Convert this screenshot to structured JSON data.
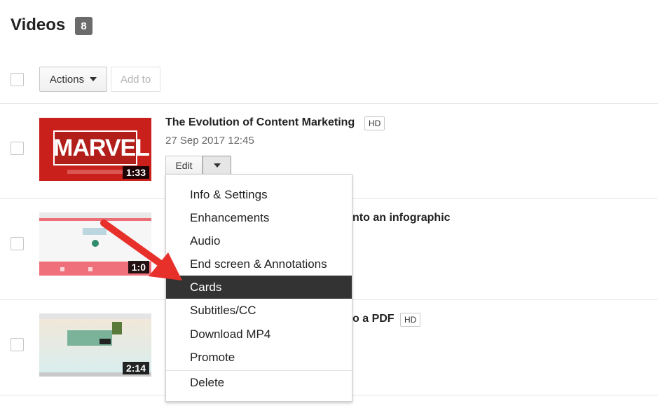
{
  "header": {
    "title": "Videos",
    "count": "8"
  },
  "toolbar": {
    "actions_label": "Actions",
    "add_to_label": "Add to"
  },
  "videos": [
    {
      "title": "The Evolution of Content Marketing",
      "hd": "HD",
      "date": "27 Sep 2017 12:45",
      "duration": "1:33",
      "thumb_text": "MARVEL"
    },
    {
      "title": "nto an infographic",
      "duration": "1:0"
    },
    {
      "title": "o a PDF",
      "hd": "HD",
      "duration": "2:14"
    }
  ],
  "edit_button": {
    "label": "Edit"
  },
  "menu": {
    "items": [
      "Info & Settings",
      "Enhancements",
      "Audio",
      "End screen & Annotations",
      "Cards",
      "Subtitles/CC",
      "Download MP4",
      "Promote",
      "Delete"
    ],
    "active_item": "Cards"
  },
  "colors": {
    "menu_active_bg": "#333333",
    "count_badge_bg": "#6b6b6b",
    "arrow": "#e8302a",
    "thumb_marvel_bg": "#c9201c"
  }
}
